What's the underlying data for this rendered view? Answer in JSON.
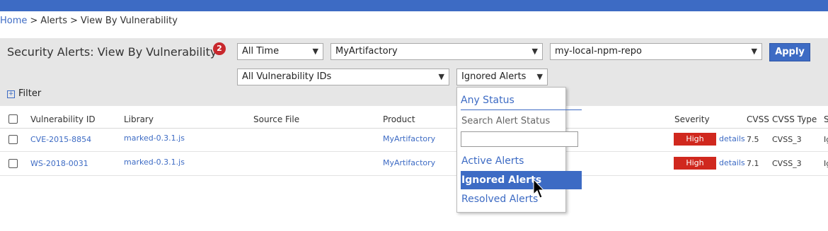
{
  "breadcrumb": {
    "home": "Home",
    "sep": ">",
    "alerts": "Alerts",
    "current": "View By Vulnerability"
  },
  "header": {
    "title": "Security Alerts: View By Vulnerability",
    "badge_count": "2"
  },
  "filters": {
    "time": "All Time",
    "organization": "MyArtifactory",
    "repository": "my-local-npm-repo",
    "vulnerability_ids": "All Vulnerability IDs",
    "status": "Ignored Alerts",
    "apply_label": "Apply",
    "filter_label": "Filter"
  },
  "table": {
    "columns": [
      "Vulnerability ID",
      "Library",
      "Source File",
      "Product",
      "Severity",
      "CVSS",
      "CVSS Type",
      "S"
    ],
    "rows": [
      {
        "vuln_id": "CVE-2015-8854",
        "library": "marked-0.3.1.js",
        "product": "MyArtifactory",
        "severity": "High",
        "details": "details",
        "cvss": "7.5",
        "cvss_type": "CVSS_3",
        "extra": "Ig"
      },
      {
        "vuln_id": "WS-2018-0031",
        "library": "marked-0.3.1.js",
        "product": "MyArtifactory",
        "severity": "High",
        "details": "details",
        "cvss": "7.1",
        "cvss_type": "CVSS_3",
        "extra": "Ig"
      }
    ]
  },
  "status_dropdown": {
    "any": "Any Status",
    "search_label": "Search Alert Status",
    "search_value": "",
    "options": [
      "Active Alerts",
      "Ignored Alerts",
      "Resolved Alerts"
    ],
    "selected": "Ignored Alerts"
  },
  "colors": {
    "accent": "#3d6bc4",
    "severity_high": "#d0281e",
    "badge": "#c8282d"
  },
  "icons": [
    "chevron-down-icon",
    "expand-plus-icon",
    "mouse-pointer-icon"
  ]
}
